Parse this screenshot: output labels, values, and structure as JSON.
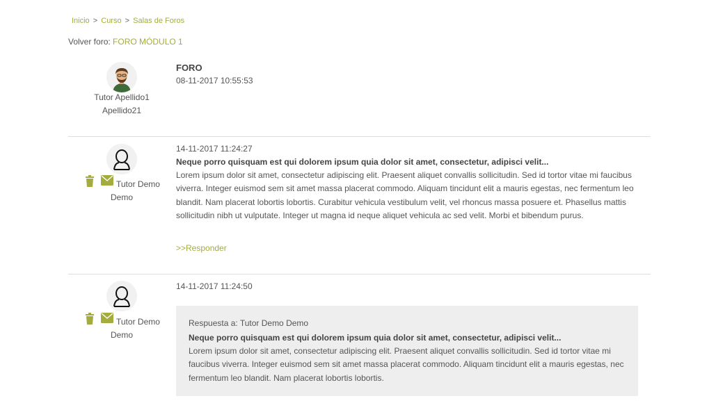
{
  "breadcrumb": {
    "items": [
      "Inicio",
      "Curso",
      "Salas de Foros"
    ],
    "separator": ">"
  },
  "volver": {
    "label": "Volver foro:",
    "link": "FORO MÓDULO 1"
  },
  "header_post": {
    "author_line1": "Tutor Apellido1",
    "author_line2": "Apellido21",
    "title": "FORO",
    "date": "08-11-2017 10:55:53"
  },
  "posts": [
    {
      "author_line1": "Tutor Demo",
      "author_line2": "Demo",
      "date": "14-11-2017 11:24:27",
      "subject": "Neque porro quisquam est qui dolorem ipsum quia dolor sit amet, consectetur, adipisci velit...",
      "body": "Lorem ipsum dolor sit amet, consectetur adipiscing elit. Praesent aliquet convallis sollicitudin. Sed id tortor vitae mi faucibus viverra. Integer euismod sem sit amet massa placerat commodo. Aliquam tincidunt elit a mauris egestas, nec fermentum leo blandit. Nam placerat lobortis lobortis. Curabitur vehicula vestibulum velit, vel rhoncus massa posuere et. Phasellus mattis sollicitudin nibh ut vulputate. Integer ut magna id neque aliquet vehicula ac sed velit. Morbi et bibendum purus.",
      "reply_label": ">>Responder"
    },
    {
      "author_line1": "Tutor Demo",
      "author_line2": "Demo",
      "date": "14-11-2017 11:24:50",
      "quote_title": "Respuesta a: Tutor Demo Demo",
      "subject": "Neque porro quisquam est qui dolorem ipsum quia dolor sit amet, consectetur, adipisci velit...",
      "body": "Lorem ipsum dolor sit amet, consectetur adipiscing elit. Praesent aliquet convallis sollicitudin. Sed id tortor vitae mi faucibus viverra. Integer euismod sem sit amet massa placerat commodo. Aliquam tincidunt elit a mauris egestas, nec fermentum leo blandit. Nam placerat lobortis lobortis."
    }
  ],
  "colors": {
    "accent": "#a3ac3c",
    "quote_bg": "#eeeeee",
    "divider": "#dddddd"
  },
  "icons": [
    "trash-icon",
    "envelope-icon",
    "avatar-photo-icon",
    "user-outline-icon"
  ]
}
